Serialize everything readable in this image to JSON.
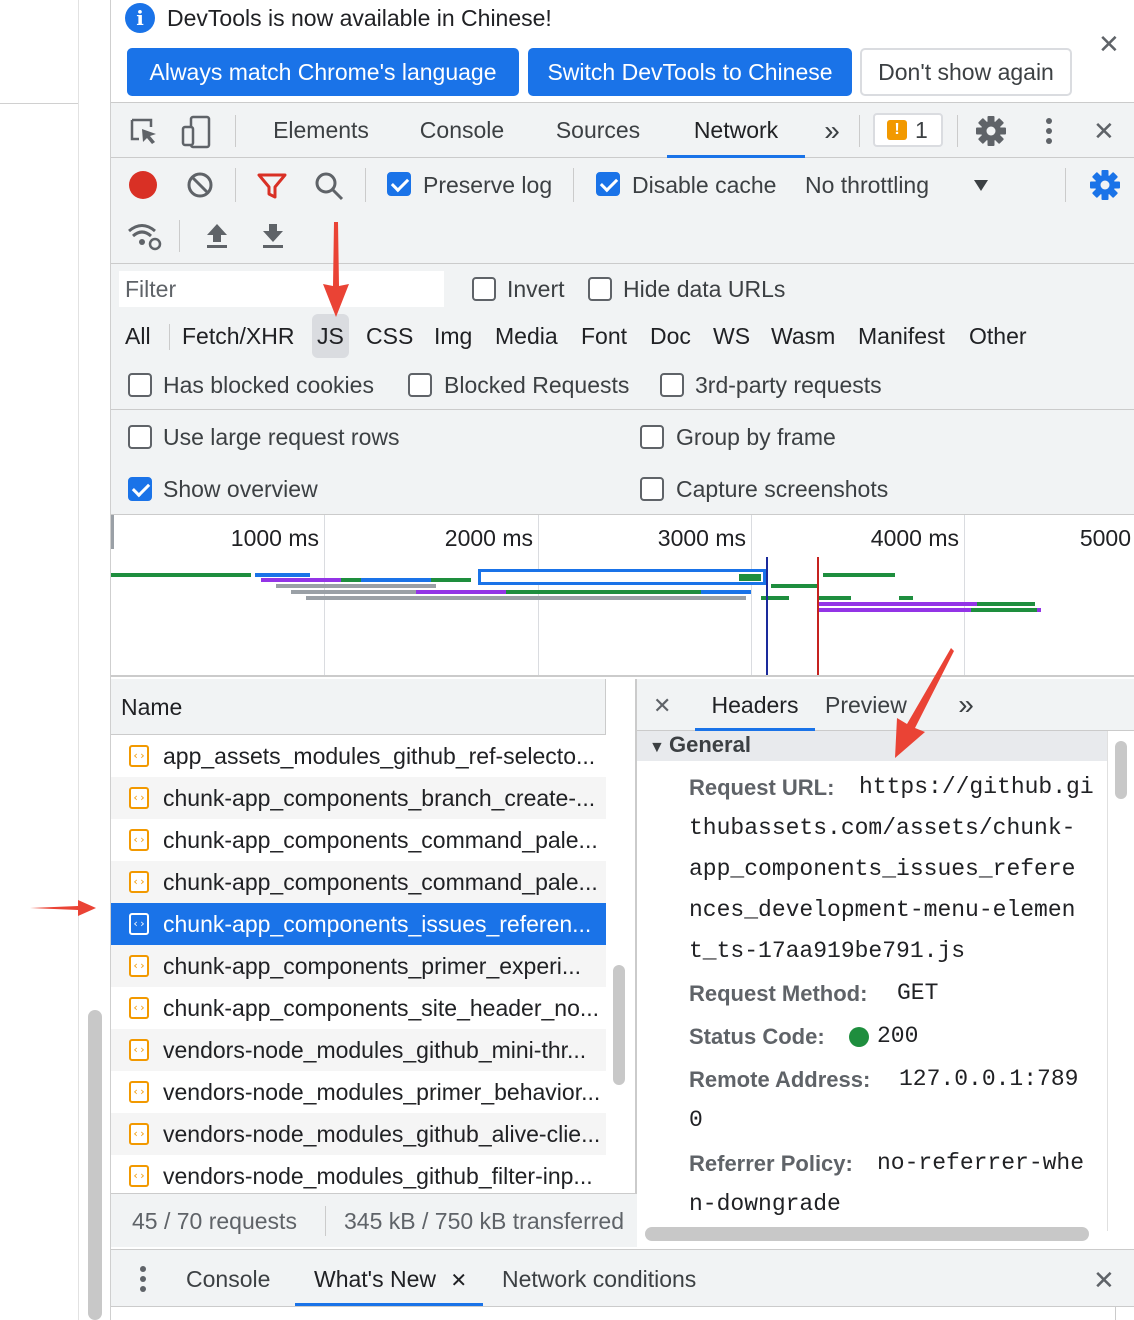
{
  "infobar": {
    "message": "DevTools is now available in Chinese!",
    "btn_match": "Always match Chrome's language",
    "btn_switch": "Switch DevTools to Chinese",
    "btn_dont_show": "Don't show again",
    "info_icon_glyph": "i"
  },
  "main_tabs": {
    "elements": "Elements",
    "console": "Console",
    "sources": "Sources",
    "network": "Network",
    "more": "»",
    "issues_count": "1"
  },
  "network_toolbar": {
    "preserve_log": "Preserve log",
    "preserve_log_checked": true,
    "disable_cache": "Disable cache",
    "disable_cache_checked": true,
    "throttling": "No throttling"
  },
  "filter": {
    "placeholder": "Filter",
    "invert": "Invert",
    "hide_data_urls": "Hide data URLs",
    "types": [
      "All",
      "Fetch/XHR",
      "JS",
      "CSS",
      "Img",
      "Media",
      "Font",
      "Doc",
      "WS",
      "Wasm",
      "Manifest",
      "Other"
    ],
    "active_type": "JS",
    "has_blocked_cookies": "Has blocked cookies",
    "blocked_requests": "Blocked Requests",
    "third_party": "3rd-party requests"
  },
  "settings": {
    "large_rows": "Use large request rows",
    "group_by_frame": "Group by frame",
    "show_overview": "Show overview",
    "show_overview_checked": true,
    "capture_screenshots": "Capture screenshots"
  },
  "overview": {
    "ticks": [
      "1000 ms",
      "2000 ms",
      "3000 ms",
      "4000 ms",
      "5000"
    ]
  },
  "request_list": {
    "header": "Name",
    "rows": [
      "app_assets_modules_github_ref-selecto...",
      "chunk-app_components_branch_create-...",
      "chunk-app_components_command_pale...",
      "chunk-app_components_command_pale...",
      "chunk-app_components_issues_referen...",
      "chunk-app_components_primer_experi...",
      "chunk-app_components_site_header_no...",
      "vendors-node_modules_github_mini-thr...",
      "vendors-node_modules_primer_behavior...",
      "vendors-node_modules_github_alive-clie...",
      "vendors-node_modules_github_filter-inp..."
    ],
    "selected_index": 4,
    "footer_requests": "45 / 70 requests",
    "footer_transferred": "345 kB / 750 kB transferred"
  },
  "details": {
    "tabs": {
      "headers": "Headers",
      "preview": "Preview",
      "more": "»"
    },
    "section": "General",
    "request_url_key": "Request URL:",
    "request_url_lines": [
      "https://github.gi",
      "thubassets.com/assets/chunk-",
      "app_components_issues_refere",
      "nces_development-menu-elemen",
      "t_ts-17aa919be791.js"
    ],
    "method_key": "Request Method:",
    "method": "GET",
    "status_key": "Status Code:",
    "status": "200",
    "status_color": "#1e8e3e",
    "remote_key": "Remote Address:",
    "remote_lines": [
      "127.0.0.1:789",
      "0"
    ],
    "referrer_key": "Referrer Policy:",
    "referrer_lines": [
      "no-referrer-whe",
      "n-downgrade"
    ]
  },
  "drawer": {
    "console": "Console",
    "whats_new": "What's New",
    "network_conditions": "Network conditions"
  },
  "colors": {
    "accent": "#1a73e8",
    "annotation_arrow": "#ea4335"
  }
}
